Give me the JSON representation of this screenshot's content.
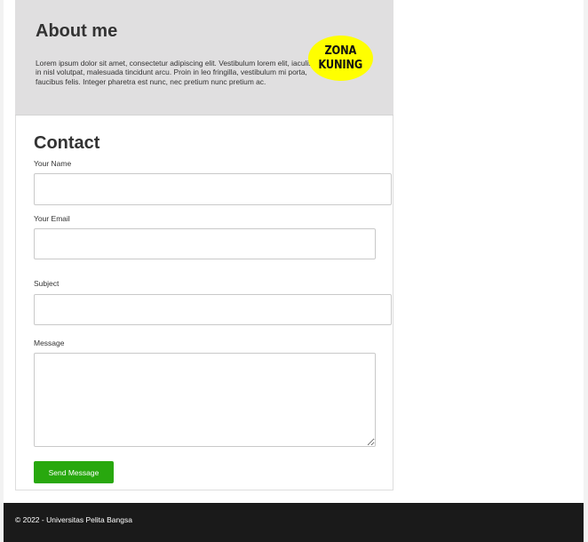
{
  "about": {
    "title": "About me",
    "text": "Lorem ipsum dolor sit amet, consectetur adipiscing elit. Vestibulum lorem elit, iaculis in nisl volutpat, malesuada tincidunt arcu. Proin in leo fringilla, vestibulum mi porta, faucibus felis. Integer pharetra est nunc, nec pretium nunc pretium ac.",
    "logo_line1": "ZONA",
    "logo_line2": "KUNING"
  },
  "contact": {
    "title": "Contact",
    "name_label": "Your Name",
    "name_value": "",
    "email_label": "Your Email",
    "email_value": "",
    "subject_label": "Subject",
    "subject_value": "",
    "message_label": "Message",
    "message_value": "",
    "send_label": "Send Message"
  },
  "footer": {
    "text": "© 2022 - Universitas Pelita Bangsa"
  },
  "colors": {
    "about_background": "#e0dfe0",
    "logo_background": "#ffff00",
    "send_button": "#28a80e",
    "footer_background": "#1a1a1a"
  }
}
